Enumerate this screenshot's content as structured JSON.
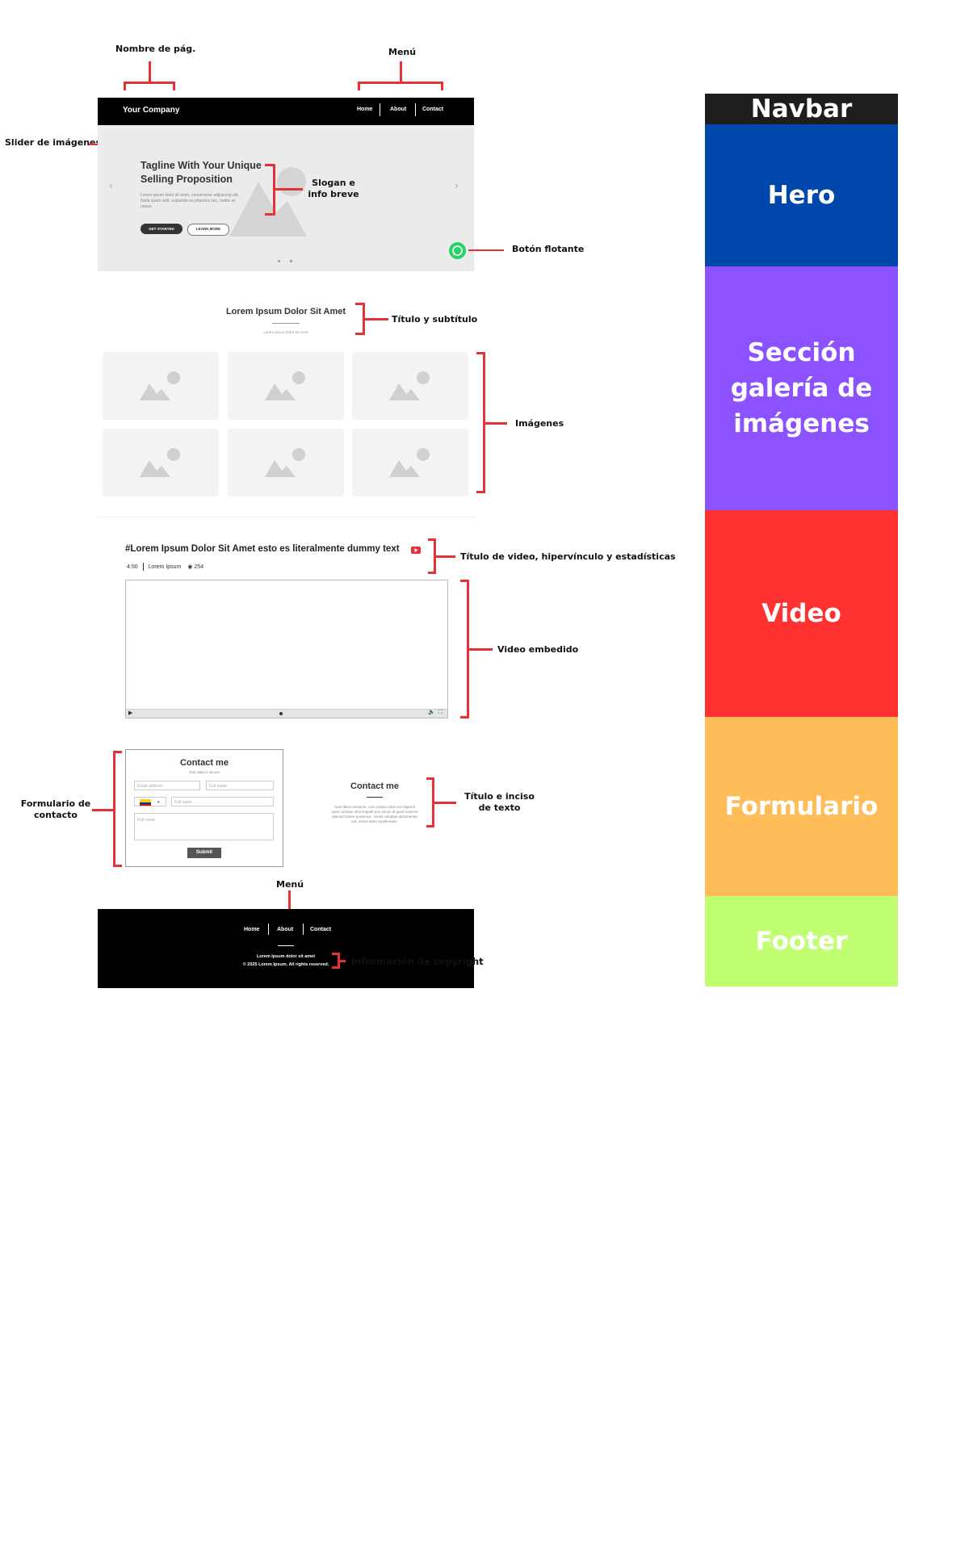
{
  "annotations": {
    "page_name": "Nombre de pág.",
    "menu_top": "Menú",
    "slider": "Slider de imágenes",
    "slogan": "Slogan e info breve",
    "floating_button": "Botón flotante",
    "title_subtitle": "Título y subtítulo",
    "images": "Imágenes",
    "video_title_info": "Título de video, hipervínculo y estadísticas",
    "video_embedded": "Video embedido",
    "contact_form": "Formulario de contacto",
    "title_text": "Título e inciso de texto",
    "menu_footer": "Menú",
    "copyright_info": "Información de copyright"
  },
  "wireframe": {
    "navbar": {
      "brand": "Your Company",
      "items": [
        "Home",
        "About",
        "Contact"
      ]
    },
    "hero": {
      "tagline": "Tagline With Your Unique Selling Proposition",
      "text": "Lorem ipsum dolor sit amet, consectetur adipiscing elit. Nulla quam velit, vulputate eu pharetra nec, mattis ac neque.",
      "primary_button": "GET STARTED",
      "secondary_button": "LEARN MORE",
      "prev_arrow": "‹",
      "next_arrow": "›"
    },
    "gallery": {
      "title": "Lorem Ipsum Dolor Sit Amet",
      "subtitle": "Lorem ipsum Dolor sit Amet"
    },
    "video": {
      "title": "#Lorem Ipsum Dolor Sit Amet esto es literalmente dummy text",
      "duration": "4:50",
      "author": "Lorem Ipsum",
      "views": "254"
    },
    "form": {
      "title": "Contact me",
      "subtitle": "Your data is secure",
      "email_placeholder": "Email address",
      "name_placeholder": "Full name",
      "phone_placeholder": "Full name",
      "message_placeholder": "Full name",
      "submit": "Submit"
    },
    "contact_text": {
      "title": "Contact me",
      "text": "Nam libero tempore, cum soluta nobis est eligendi optio cumque nihil impedit quo minus id quod maxime placeat facere possimus, omnis voluptas assumenda est, omnis dolor repellendus."
    },
    "footer": {
      "items": [
        "Home",
        "About",
        "Contact"
      ],
      "copyright_line1": "Lorem Ipsum dolor sit amet",
      "copyright_line2": "© 2025 Lorem Ipsum.  All rights reserved."
    }
  },
  "legend": [
    {
      "label": "Navbar",
      "color": "#1e1e1e"
    },
    {
      "label": "Hero",
      "color": "#0047ab"
    },
    {
      "label": "Sección galería de imágenes",
      "color": "#8c52ff"
    },
    {
      "label": "Video",
      "color": "#ff3131"
    },
    {
      "label": "Formulario",
      "color": "#ffbd59"
    },
    {
      "label": "Footer",
      "color": "#c1ff72"
    }
  ],
  "colors": {
    "annotation_bracket": "#e53238",
    "whatsapp": "#25d366",
    "youtube": "#e53238"
  }
}
